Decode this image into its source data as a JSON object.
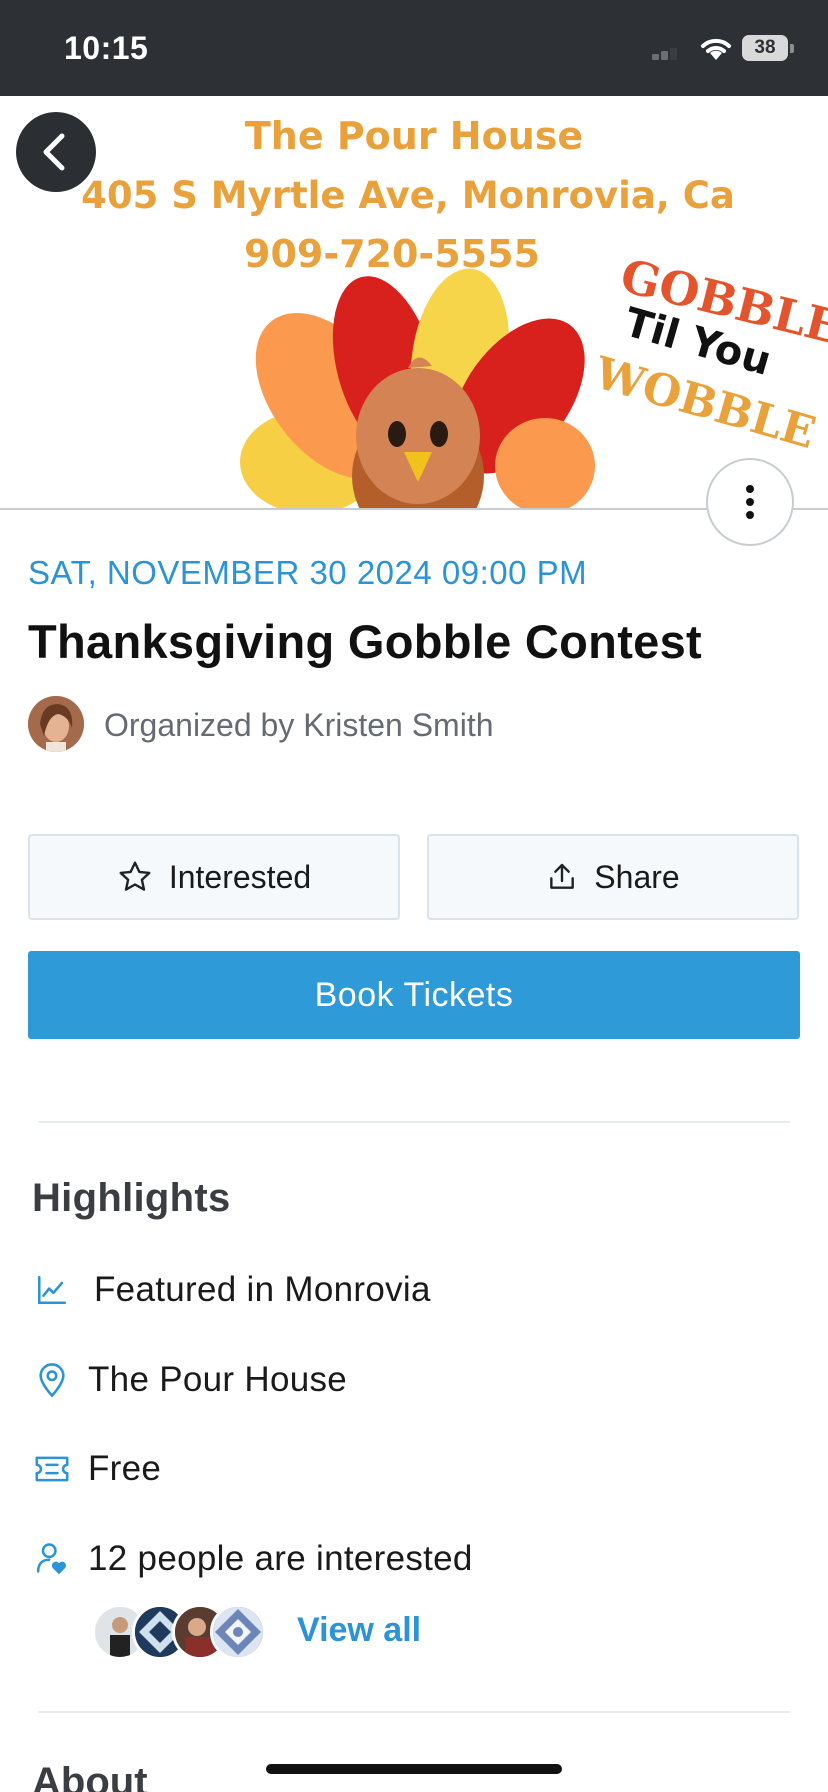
{
  "status_bar": {
    "time": "10:15",
    "battery": "38"
  },
  "hero": {
    "line1": "The Pour House",
    "line2": "405 S Myrtle Ave, Monrovia, Ca",
    "line3": "909-720-5555",
    "art_word1": "GOBBLE",
    "art_word2": "Til You",
    "art_word3": "WOBBLE"
  },
  "event": {
    "date": "SAT, NOVEMBER 30 2024 09:00 PM",
    "title": "Thanksgiving Gobble Contest",
    "organizer": "Organized by Kristen Smith"
  },
  "actions": {
    "interested_label": "Interested",
    "share_label": "Share",
    "book_label": "Book Tickets"
  },
  "highlights": {
    "title": "Highlights",
    "items": [
      {
        "icon": "trending-chart-icon",
        "text": "Featured in Monrovia"
      },
      {
        "icon": "location-pin-icon",
        "text": "The Pour House"
      },
      {
        "icon": "ticket-icon",
        "text": "Free"
      },
      {
        "icon": "person-heart-icon",
        "text": "12 people are interested"
      }
    ],
    "view_all_label": "View all"
  },
  "about": {
    "title": "About"
  },
  "colors": {
    "accent": "#2b93d6",
    "button_primary": "#2f9ad8",
    "hero_text": "#e9a23b",
    "status_bar": "#2d3035"
  }
}
